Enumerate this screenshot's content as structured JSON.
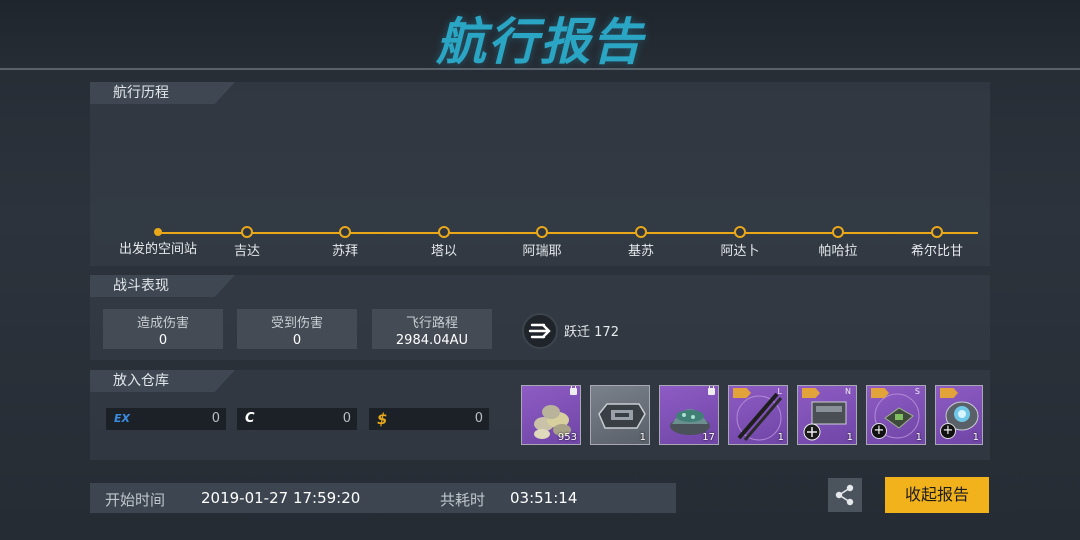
{
  "header": {
    "title": "航行报告"
  },
  "voyage": {
    "label": "航行历程",
    "stops": [
      "出发的空间站",
      "吉达",
      "苏拜",
      "塔以",
      "阿瑞耶",
      "基苏",
      "阿达卜",
      "帕哈拉",
      "希尔比甘"
    ]
  },
  "combat": {
    "label": "战斗表现",
    "stats": [
      {
        "key": "造成伤害",
        "value": "0"
      },
      {
        "key": "受到伤害",
        "value": "0"
      },
      {
        "key": "飞行路程",
        "value": "2984.04AU"
      }
    ],
    "jump_label": "跃迁",
    "jump_value": "172"
  },
  "storage": {
    "label": "放入仓库",
    "currencies": [
      {
        "icon": "EX",
        "icon_name": "ex-currency-icon",
        "color": "#3a8ce0",
        "amount": "0"
      },
      {
        "icon": "C",
        "icon_name": "credit-currency-icon",
        "color": "#ffffff",
        "amount": "0"
      },
      {
        "icon": "$",
        "icon_name": "dollar-currency-icon",
        "color": "#e8a81a",
        "amount": "0"
      }
    ],
    "items": [
      {
        "icon": "ore-pile-icon",
        "count": "953",
        "locked": true,
        "rarity": "purple"
      },
      {
        "icon": "armor-plate-icon",
        "count": "1",
        "locked": false,
        "rarity": "gray"
      },
      {
        "icon": "crystal-dome-icon",
        "count": "17",
        "locked": true,
        "rarity": "purple"
      },
      {
        "icon": "rail-barrel-icon",
        "count": "1",
        "slot": "L",
        "level_tag": true,
        "rarity": "purple"
      },
      {
        "icon": "engine-module-icon",
        "count": "1",
        "slot": "N",
        "level_tag": true,
        "rarity": "purple"
      },
      {
        "icon": "circuit-module-icon",
        "count": "1",
        "slot": "S",
        "level_tag": true,
        "rarity": "purple"
      },
      {
        "icon": "reactor-core-icon",
        "count": "1",
        "slot": "",
        "level_tag": true,
        "rarity": "purple"
      }
    ]
  },
  "time": {
    "start_label": "开始时间",
    "start_value": "2019-01-27 17:59:20",
    "duration_label": "共耗时",
    "duration_value": "03:51:14"
  },
  "actions": {
    "collect_label": "收起报告"
  },
  "colors": {
    "accent": "#e8a81a",
    "title": "#2aa6c4",
    "button": "#f2b21c",
    "item_purple": "#7d4fb8"
  }
}
